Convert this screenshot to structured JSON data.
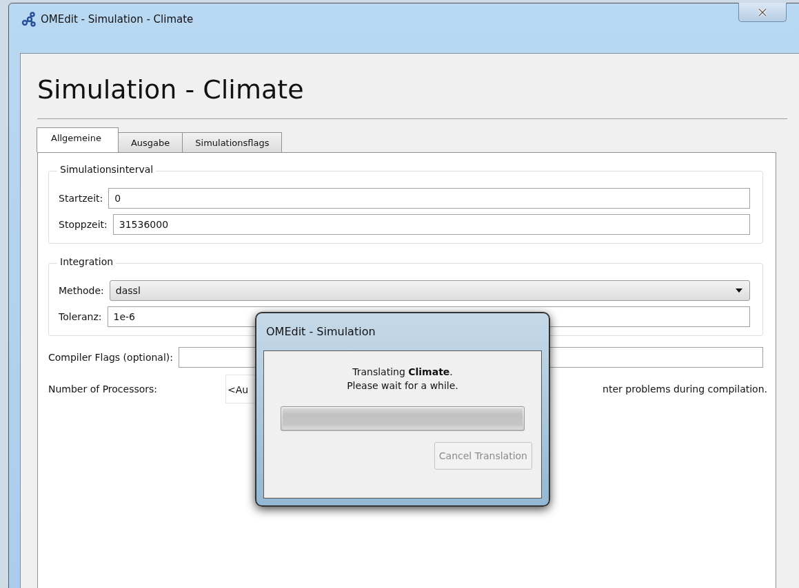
{
  "window": {
    "title": "OMEdit - Simulation - Climate"
  },
  "heading": "Simulation - Climate",
  "tabs": [
    {
      "label": "Allgemeine",
      "selected": true
    },
    {
      "label": "Ausgabe",
      "selected": false
    },
    {
      "label": "Simulationsflags",
      "selected": false
    }
  ],
  "groups": [
    {
      "title": "Simulationsinterval",
      "fields": [
        {
          "label": "Startzeit:",
          "value": "0",
          "kind": "text"
        },
        {
          "label": "Stoppzeit:",
          "value": "31536000",
          "kind": "text"
        }
      ]
    },
    {
      "title": "Integration",
      "fields": [
        {
          "label": "Methode:",
          "value": "dassl",
          "kind": "dropdown"
        },
        {
          "label": "Toleranz:",
          "value": "1e-6",
          "kind": "text"
        }
      ]
    }
  ],
  "compiler_flags": {
    "label": "Compiler Flags (optional):"
  },
  "processors": {
    "label": "Number of Processors:",
    "value": "<Au",
    "note": "nter problems during compilation."
  },
  "dialog": {
    "title": "OMEdit - Simulation",
    "message": "Translating **Climate**.",
    "message_2": "Please wait for a while.",
    "progress": {
      "level": 1
    },
    "cancel_button": {
      "label": "Cancel Translation",
      "disabled": true
    }
  }
}
